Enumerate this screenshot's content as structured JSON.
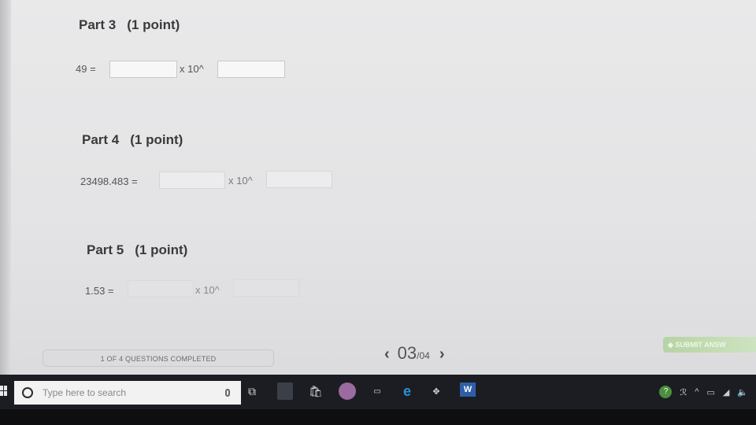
{
  "parts": [
    {
      "title": "Part 3",
      "points": "(1 point)",
      "lhs": "49 =",
      "times": "x 10^"
    },
    {
      "title": "Part 4",
      "points": "(1 point)",
      "lhs": "23498.483 =",
      "times": "x 10^"
    },
    {
      "title": "Part 5",
      "points": "(1 point)",
      "lhs": "1.53 =",
      "times": "x 10^"
    }
  ],
  "footer": {
    "progress_text": "1 OF 4 QUESTIONS COMPLETED",
    "pager_prev": "‹",
    "pager_current": "03",
    "pager_total": "/04",
    "pager_next": "›",
    "submit_label": "SUBMIT ANSW"
  },
  "taskbar": {
    "search_placeholder": "Type here to search",
    "tray_text": "ℛ"
  }
}
